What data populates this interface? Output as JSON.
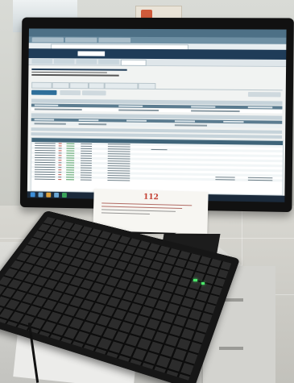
{
  "note": {
    "number": "112"
  },
  "colors": {
    "note_number": "#c23a2c",
    "app_header": "#1f3c58",
    "led": "#4be86a"
  }
}
